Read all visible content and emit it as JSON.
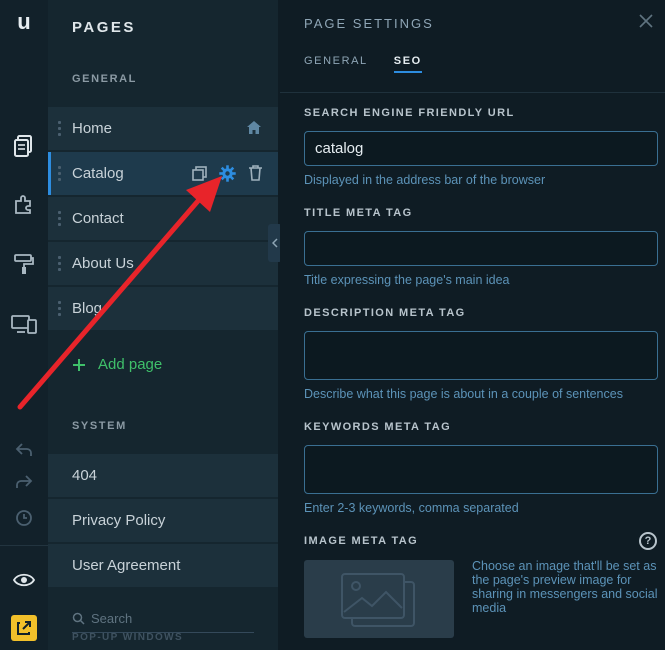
{
  "rail": {
    "logo": "u",
    "icons": [
      "pages-icon",
      "apps-icon",
      "design-icon",
      "devices-icon",
      "undo-icon",
      "redo-icon",
      "history-icon",
      "preview-icon",
      "publish-icon"
    ]
  },
  "pages_panel": {
    "title": "PAGES",
    "general_label": "GENERAL",
    "pages": [
      {
        "label": "Home"
      },
      {
        "label": "Catalog"
      },
      {
        "label": "Contact"
      },
      {
        "label": "About Us"
      },
      {
        "label": "Blog"
      }
    ],
    "add_page": "Add page",
    "system_label": "SYSTEM",
    "system_pages": [
      {
        "label": "404"
      },
      {
        "label": "Privacy Policy"
      },
      {
        "label": "User Agreement"
      }
    ],
    "search_placeholder": "Search",
    "popup_label": "POP-UP WINDOWS"
  },
  "settings": {
    "title": "PAGE SETTINGS",
    "tabs": [
      {
        "label": "GENERAL",
        "active": false
      },
      {
        "label": "SEO",
        "active": true
      }
    ],
    "url_label": "SEARCH ENGINE FRIENDLY URL",
    "url_value": "catalog",
    "url_help": "Displayed in the address bar of the browser",
    "title_label": "TITLE META TAG",
    "title_value": "",
    "title_help": "Title expressing the page's main idea",
    "description_label": "DESCRIPTION META TAG",
    "description_value": "",
    "description_help": "Describe what this page is about in a couple of sentences",
    "keywords_label": "KEYWORDS META TAG",
    "keywords_value": "",
    "keywords_help": "Enter 2-3 keywords, comma separated",
    "image_label": "IMAGE META TAG",
    "image_help_icon": "?",
    "image_desc": "Choose an image that'll be set as the page's preview image for sharing in messengers and social media"
  },
  "colors": {
    "accent": "#2d8de0",
    "add_green": "#3fc06a",
    "annotation_red": "#e8242a",
    "publish_yellow": "#f2c02a"
  }
}
